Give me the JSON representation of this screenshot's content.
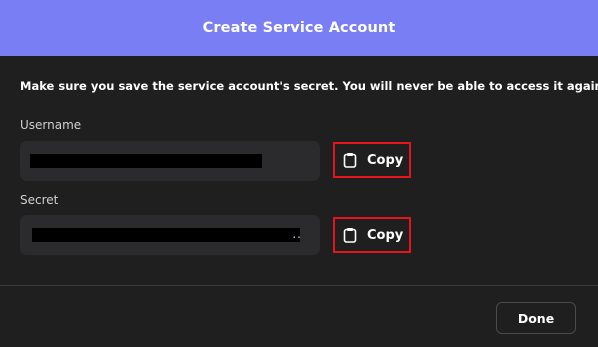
{
  "dialog": {
    "title": "Create Service Account",
    "warning": "Make sure you save the service account's secret. You will never be able to access it again."
  },
  "username": {
    "label": "Username",
    "copy_label": "Copy"
  },
  "secret": {
    "label": "Secret",
    "trailing": "..",
    "copy_label": "Copy"
  },
  "footer": {
    "done_label": "Done"
  },
  "colors": {
    "header_bg": "#7a7ef4",
    "dialog_bg": "#1f1f20",
    "field_bg": "#2b2b2e",
    "highlight_border": "#e4161b"
  },
  "icons": {
    "copy": "clipboard-icon"
  }
}
